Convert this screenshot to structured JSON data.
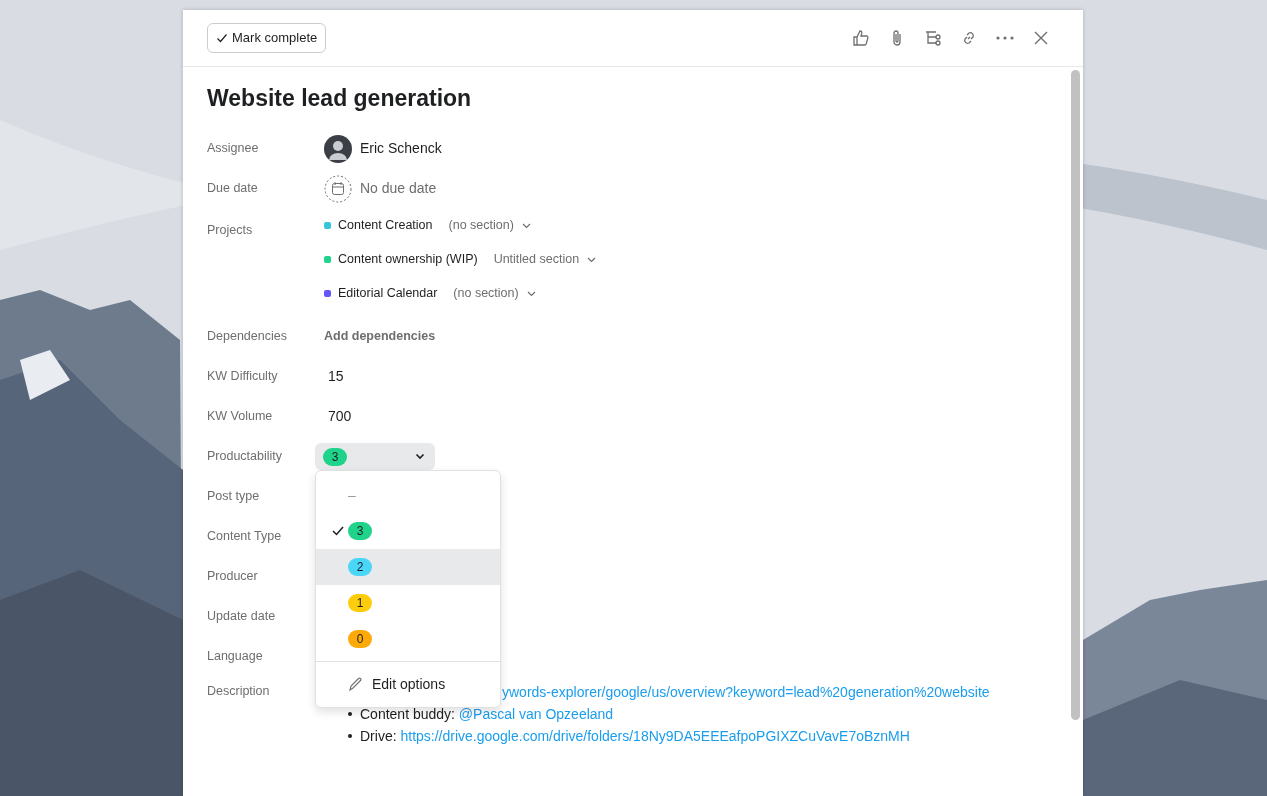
{
  "toolbar": {
    "mark_complete": "Mark complete"
  },
  "task": {
    "title": "Website lead generation",
    "fields": [
      {
        "kind": "assignee",
        "label": "Assignee",
        "value": "Eric Schenck"
      },
      {
        "kind": "date",
        "label": "Due date",
        "value": "No due date"
      },
      {
        "kind": "projects",
        "label": "Projects",
        "projects": [
          {
            "name": "Content Creation",
            "section": "(no section)",
            "color": "#37c5d9"
          },
          {
            "name": "Content ownership (WIP)",
            "section": "Untitled section",
            "color": "#1fd38a"
          },
          {
            "name": "Editorial Calendar",
            "section": "(no section)",
            "color": "#6457f9"
          }
        ]
      },
      {
        "kind": "action",
        "label": "Dependencies",
        "value": "Add dependencies"
      },
      {
        "kind": "text",
        "label": "KW Difficulty",
        "value": "15"
      },
      {
        "kind": "text",
        "label": "KW Volume",
        "value": "700"
      },
      {
        "kind": "select",
        "label": "Productability",
        "value": "3",
        "color": "#1fd38a"
      },
      {
        "kind": "empty",
        "label": "Post type"
      },
      {
        "kind": "empty",
        "label": "Content Type"
      },
      {
        "kind": "empty",
        "label": "Producer"
      },
      {
        "kind": "empty",
        "label": "Update date"
      },
      {
        "kind": "empty",
        "label": "Language"
      },
      {
        "kind": "description",
        "label": "Description"
      }
    ],
    "description": [
      {
        "kind": "hidden_link",
        "link": "ywords-explorer/google/us/overview?keyword=lead%20generation%20website"
      },
      {
        "kind": "bullet",
        "text": "Content buddy: ",
        "link": "@Pascal van Opzeeland"
      },
      {
        "kind": "bullet",
        "text": "Drive: ",
        "link": "https://drive.google.com/drive/folders/18Ny9DA5EEEafpoPGIXZCuVavE7oBznMH"
      }
    ]
  },
  "dropdown": {
    "options": [
      {
        "kind": "empty",
        "label": "–",
        "selected": false,
        "hovered": false
      },
      {
        "kind": "badge",
        "label": "3",
        "color": "#1fd38a",
        "selected": true,
        "hovered": false
      },
      {
        "kind": "badge",
        "label": "2",
        "color": "#4ad6f7",
        "selected": false,
        "hovered": true
      },
      {
        "kind": "badge",
        "label": "1",
        "color": "#fdcc0c",
        "selected": false,
        "hovered": false
      },
      {
        "kind": "badge",
        "label": "0",
        "color": "#fda90a",
        "selected": false,
        "hovered": false
      }
    ],
    "edit": "Edit options"
  }
}
